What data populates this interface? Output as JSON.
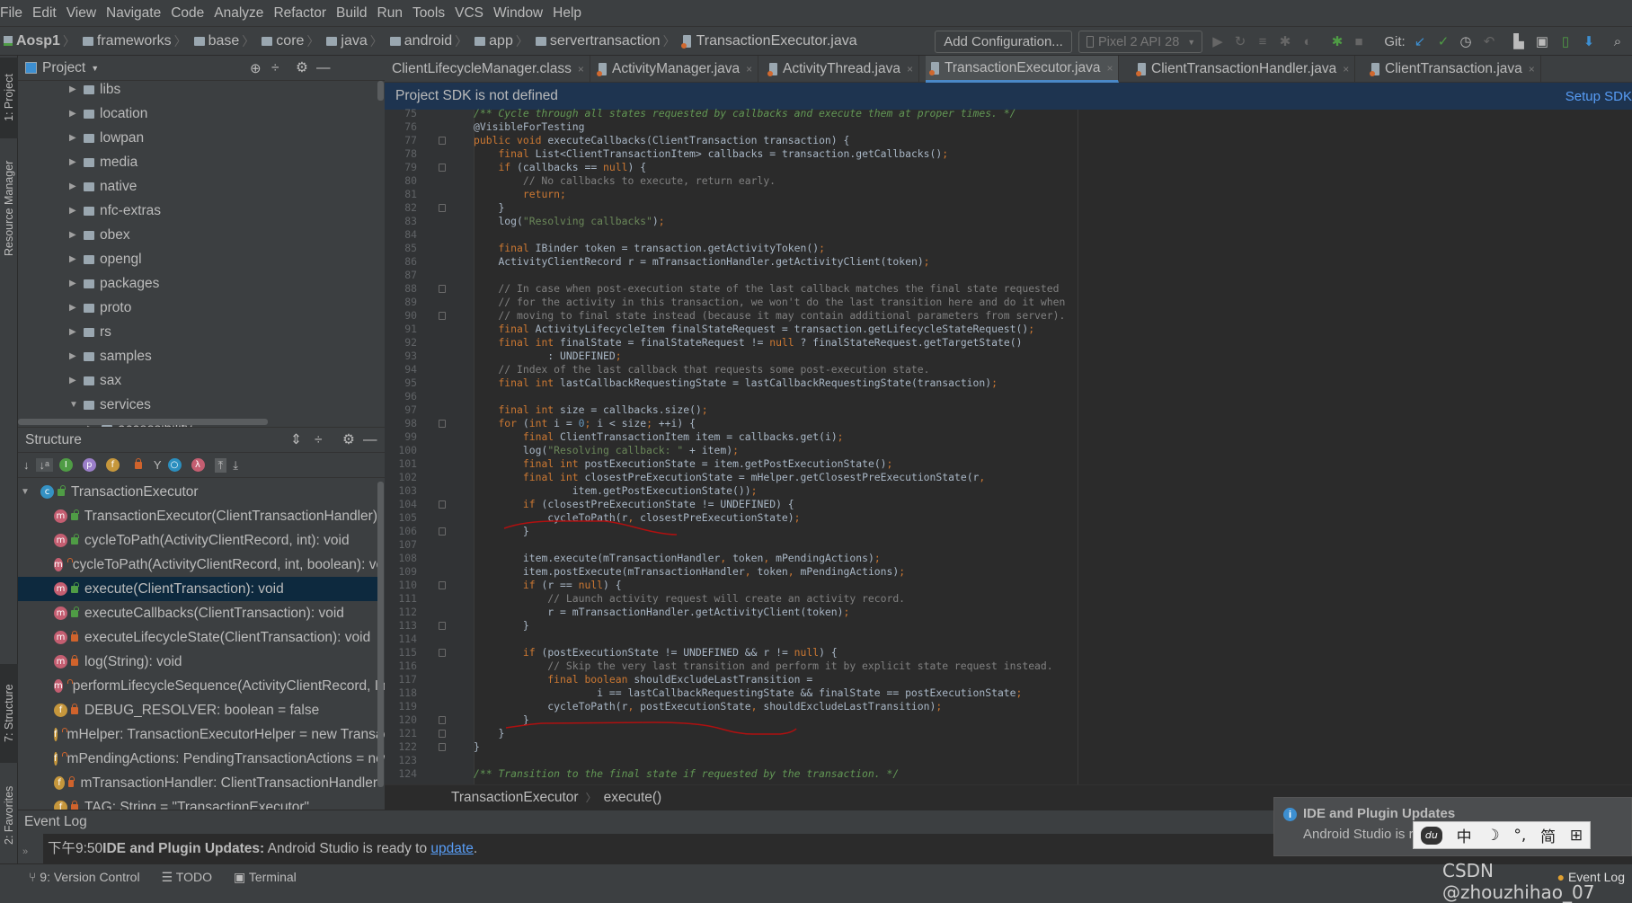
{
  "menu": [
    "File",
    "Edit",
    "View",
    "Navigate",
    "Code",
    "Analyze",
    "Refactor",
    "Build",
    "Run",
    "Tools",
    "VCS",
    "Window",
    "Help"
  ],
  "breadcrumbs": [
    "Aosp1",
    "frameworks",
    "base",
    "core",
    "java",
    "android",
    "app",
    "servertransaction",
    "TransactionExecutor.java"
  ],
  "toolbar": {
    "add_configuration": "Add Configuration...",
    "device": "Pixel 2 API 28",
    "git_label": "Git:"
  },
  "side_stripe": {
    "project": "1: Project",
    "resource_manager": "Resource Manager",
    "structure": "7: Structure",
    "favorites": "2: Favorites"
  },
  "project_panel": {
    "title": "Project",
    "items": [
      {
        "label": "libs",
        "expanded": false
      },
      {
        "label": "location",
        "expanded": false
      },
      {
        "label": "lowpan",
        "expanded": false
      },
      {
        "label": "media",
        "expanded": false
      },
      {
        "label": "native",
        "expanded": false
      },
      {
        "label": "nfc-extras",
        "expanded": false
      },
      {
        "label": "obex",
        "expanded": false
      },
      {
        "label": "opengl",
        "expanded": false
      },
      {
        "label": "packages",
        "expanded": false
      },
      {
        "label": "proto",
        "expanded": false
      },
      {
        "label": "rs",
        "expanded": false
      },
      {
        "label": "samples",
        "expanded": false
      },
      {
        "label": "sax",
        "expanded": false
      },
      {
        "label": "services",
        "expanded": true
      },
      {
        "label": "accessibility",
        "expanded": false
      }
    ]
  },
  "structure_panel": {
    "title": "Structure",
    "root": "TransactionExecutor",
    "items": [
      {
        "label": "TransactionExecutor(ClientTransactionHandler)",
        "kind": "method",
        "access": "public"
      },
      {
        "label": "cycleToPath(ActivityClientRecord, int): void",
        "kind": "method",
        "access": "public"
      },
      {
        "label": "cycleToPath(ActivityClientRecord, int, boolean): void",
        "kind": "method",
        "access": "private"
      },
      {
        "label": "execute(ClientTransaction): void",
        "kind": "method",
        "access": "public",
        "selected": true
      },
      {
        "label": "executeCallbacks(ClientTransaction): void",
        "kind": "method",
        "access": "public"
      },
      {
        "label": "executeLifecycleState(ClientTransaction): void",
        "kind": "method",
        "access": "private"
      },
      {
        "label": "log(String): void",
        "kind": "method",
        "access": "private"
      },
      {
        "label": "performLifecycleSequence(ActivityClientRecord, IntArray): void",
        "kind": "method",
        "access": "private"
      },
      {
        "label": "DEBUG_RESOLVER: boolean = false",
        "kind": "field",
        "access": "private"
      },
      {
        "label": "mHelper: TransactionExecutorHelper = new TransactionExecutorHelper()",
        "kind": "field",
        "access": "private"
      },
      {
        "label": "mPendingActions: PendingTransactionActions = new PendingTransactionActions()",
        "kind": "field",
        "access": "private"
      },
      {
        "label": "mTransactionHandler: ClientTransactionHandler",
        "kind": "field",
        "access": "private"
      },
      {
        "label": "TAG: String = \"TransactionExecutor\"",
        "kind": "field",
        "access": "private"
      }
    ]
  },
  "editor": {
    "tabs": [
      {
        "label": "ClientLifecycleManager.class",
        "active": false
      },
      {
        "label": "ActivityManager.java",
        "active": false
      },
      {
        "label": "ActivityThread.java",
        "active": false
      },
      {
        "label": "TransactionExecutor.java",
        "active": true
      },
      {
        "label": "ClientTransactionHandler.java",
        "active": false
      },
      {
        "label": "ClientTransaction.java",
        "active": false
      }
    ],
    "banner": "Project SDK is not defined",
    "banner_action": "Setup SDK",
    "first_line": 75,
    "fold_lines": [
      77,
      79,
      82,
      88,
      90,
      98,
      104,
      106,
      110,
      113,
      115,
      120,
      121,
      122
    ],
    "lines": [
      "/** Cycle through all states requested by callbacks and execute them at proper times. */",
      "@VisibleForTesting",
      "public void executeCallbacks(ClientTransaction transaction) {",
      "    final List<ClientTransactionItem> callbacks = transaction.getCallbacks();",
      "    if (callbacks == null) {",
      "        // No callbacks to execute, return early.",
      "        return;",
      "    }",
      "    log(\"Resolving callbacks\");",
      "",
      "    final IBinder token = transaction.getActivityToken();",
      "    ActivityClientRecord r = mTransactionHandler.getActivityClient(token);",
      "",
      "    // In case when post-execution state of the last callback matches the final state requested",
      "    // for the activity in this transaction, we won't do the last transition here and do it when",
      "    // moving to final state instead (because it may contain additional parameters from server).",
      "    final ActivityLifecycleItem finalStateRequest = transaction.getLifecycleStateRequest();",
      "    final int finalState = finalStateRequest != null ? finalStateRequest.getTargetState()",
      "            : UNDEFINED;",
      "    // Index of the last callback that requests some post-execution state.",
      "    final int lastCallbackRequestingState = lastCallbackRequestingState(transaction);",
      "",
      "    final int size = callbacks.size();",
      "    for (int i = 0; i < size; ++i) {",
      "        final ClientTransactionItem item = callbacks.get(i);",
      "        log(\"Resolving callback: \" + item);",
      "        final int postExecutionState = item.getPostExecutionState();",
      "        final int closestPreExecutionState = mHelper.getClosestPreExecutionState(r,",
      "                item.getPostExecutionState());",
      "        if (closestPreExecutionState != UNDEFINED) {",
      "            cycleToPath(r, closestPreExecutionState);",
      "        }",
      "",
      "        item.execute(mTransactionHandler, token, mPendingActions);",
      "        item.postExecute(mTransactionHandler, token, mPendingActions);",
      "        if (r == null) {",
      "            // Launch activity request will create an activity record.",
      "            r = mTransactionHandler.getActivityClient(token);",
      "        }",
      "",
      "        if (postExecutionState != UNDEFINED && r != null) {",
      "            // Skip the very last transition and perform it by explicit state request instead.",
      "            final boolean shouldExcludeLastTransition =",
      "                    i == lastCallbackRequestingState && finalState == postExecutionState;",
      "            cycleToPath(r, postExecutionState, shouldExcludeLastTransition);",
      "        }",
      "    }",
      "}",
      "",
      "/** Transition to the final state if requested by the transaction. */"
    ],
    "breadcrumb": [
      "TransactionExecutor",
      "execute()"
    ]
  },
  "event_log": {
    "title": "Event Log",
    "time": "下午9:50",
    "bold": "IDE and Plugin Updates:",
    "message": " Android Studio is ready to ",
    "link": "update",
    "suffix": "."
  },
  "status_bar": {
    "version_control": "9: Version Control",
    "todo": "TODO",
    "terminal": "Terminal",
    "event_log": "Event Log"
  },
  "notification": {
    "title": "IDE and Plugin Updates",
    "body": "Android Studio is ready to update."
  },
  "ime_bar": [
    "中",
    "☽",
    "°,",
    "简",
    "⊞"
  ],
  "watermark": "CSDN @zhouzhihao_07",
  "colors": {
    "keyword": "#cc7832",
    "string": "#6a8759",
    "comment": "#808080",
    "doc_comment": "#629755",
    "number": "#6897bb",
    "accent": "#4a88c7",
    "link": "#589df6",
    "annotation_underline": "#b01010"
  }
}
